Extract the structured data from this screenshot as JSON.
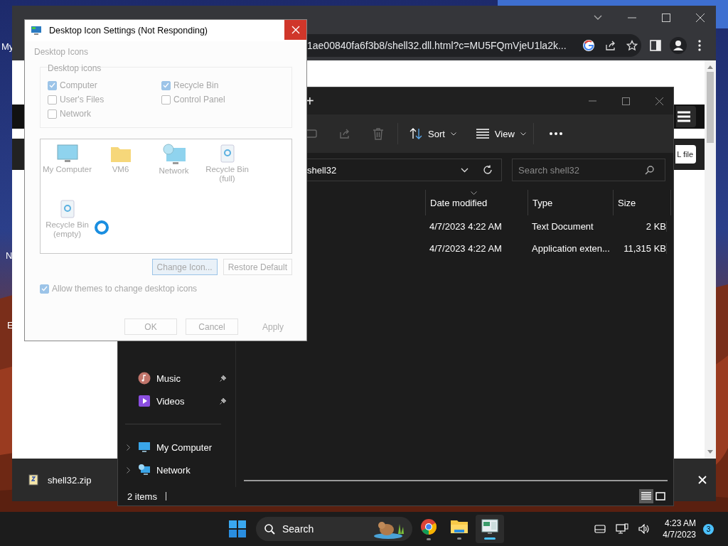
{
  "desktop": {
    "icon_labels": [
      "My",
      "N",
      "E"
    ]
  },
  "browser": {
    "address": "1ae00840fa6f3b8/shell32.dll.html?c=MU5FQmVjeU1la2k...",
    "page_button": "L file",
    "download": {
      "file": "shell32.zip"
    }
  },
  "explorer": {
    "new_tab": "+",
    "toolbar": [
      {
        "label": "Sort",
        "kind": "sort"
      },
      {
        "label": "View",
        "kind": "view"
      }
    ],
    "address": "shell32",
    "search": {
      "placeholder": "Search shell32"
    },
    "columns": [
      "Date modified",
      "Type",
      "Size"
    ],
    "rows": [
      {
        "date": "4/7/2023 4:22 AM",
        "type": "Text Document",
        "size": "2 KB"
      },
      {
        "date": "4/7/2023 4:22 AM",
        "type": "Application exten...",
        "size": "11,315 KB"
      }
    ],
    "nav": [
      {
        "label": "Music",
        "kind": "music",
        "pinned": true
      },
      {
        "label": "Videos",
        "kind": "videos",
        "pinned": true
      },
      {
        "label": "My Computer",
        "kind": "computer",
        "pinned": false
      },
      {
        "label": "Network",
        "kind": "network",
        "pinned": false
      }
    ],
    "status": "2 items",
    "view_modes": [
      {
        "kind": "details",
        "selected": true
      },
      {
        "kind": "tiles",
        "selected": false
      }
    ]
  },
  "dialog": {
    "title": "Desktop Icon Settings (Not Responding)",
    "not_responding": true,
    "tab": "Desktop Icons",
    "group": "Desktop icons",
    "checkboxes": [
      {
        "label": "Computer",
        "checked": true
      },
      {
        "label": "Recycle Bin",
        "checked": true
      },
      {
        "label": "User's Files",
        "checked": false
      },
      {
        "label": "Control Panel",
        "checked": false
      },
      {
        "label": "Network",
        "checked": false
      }
    ],
    "icons": [
      {
        "label": "My Computer",
        "kind": "monitor"
      },
      {
        "label": "VM6",
        "kind": "folder"
      },
      {
        "label": "Network",
        "kind": "network"
      },
      {
        "label": "Recycle Bin\n(full)",
        "kind": "bin"
      },
      {
        "label": "Recycle Bin\n(empty)",
        "kind": "bin"
      }
    ],
    "icon_buttons": [
      {
        "label": "Change Icon...",
        "focused": true
      },
      {
        "label": "Restore Default",
        "focused": false
      }
    ],
    "allow_themes": {
      "label": "Allow themes to change desktop icons",
      "checked": true
    },
    "footer_buttons": [
      {
        "label": "OK",
        "disabled": false
      },
      {
        "label": "Cancel",
        "disabled": false
      },
      {
        "label": "Apply",
        "disabled": true
      }
    ]
  },
  "taskbar": {
    "search": "Search",
    "apps": [
      {
        "kind": "chrome",
        "selected": false
      },
      {
        "kind": "explorer",
        "selected": false
      },
      {
        "kind": "app",
        "selected": true
      }
    ],
    "time": "4:23 AM",
    "date": "4/7/2023",
    "badge": "3"
  }
}
